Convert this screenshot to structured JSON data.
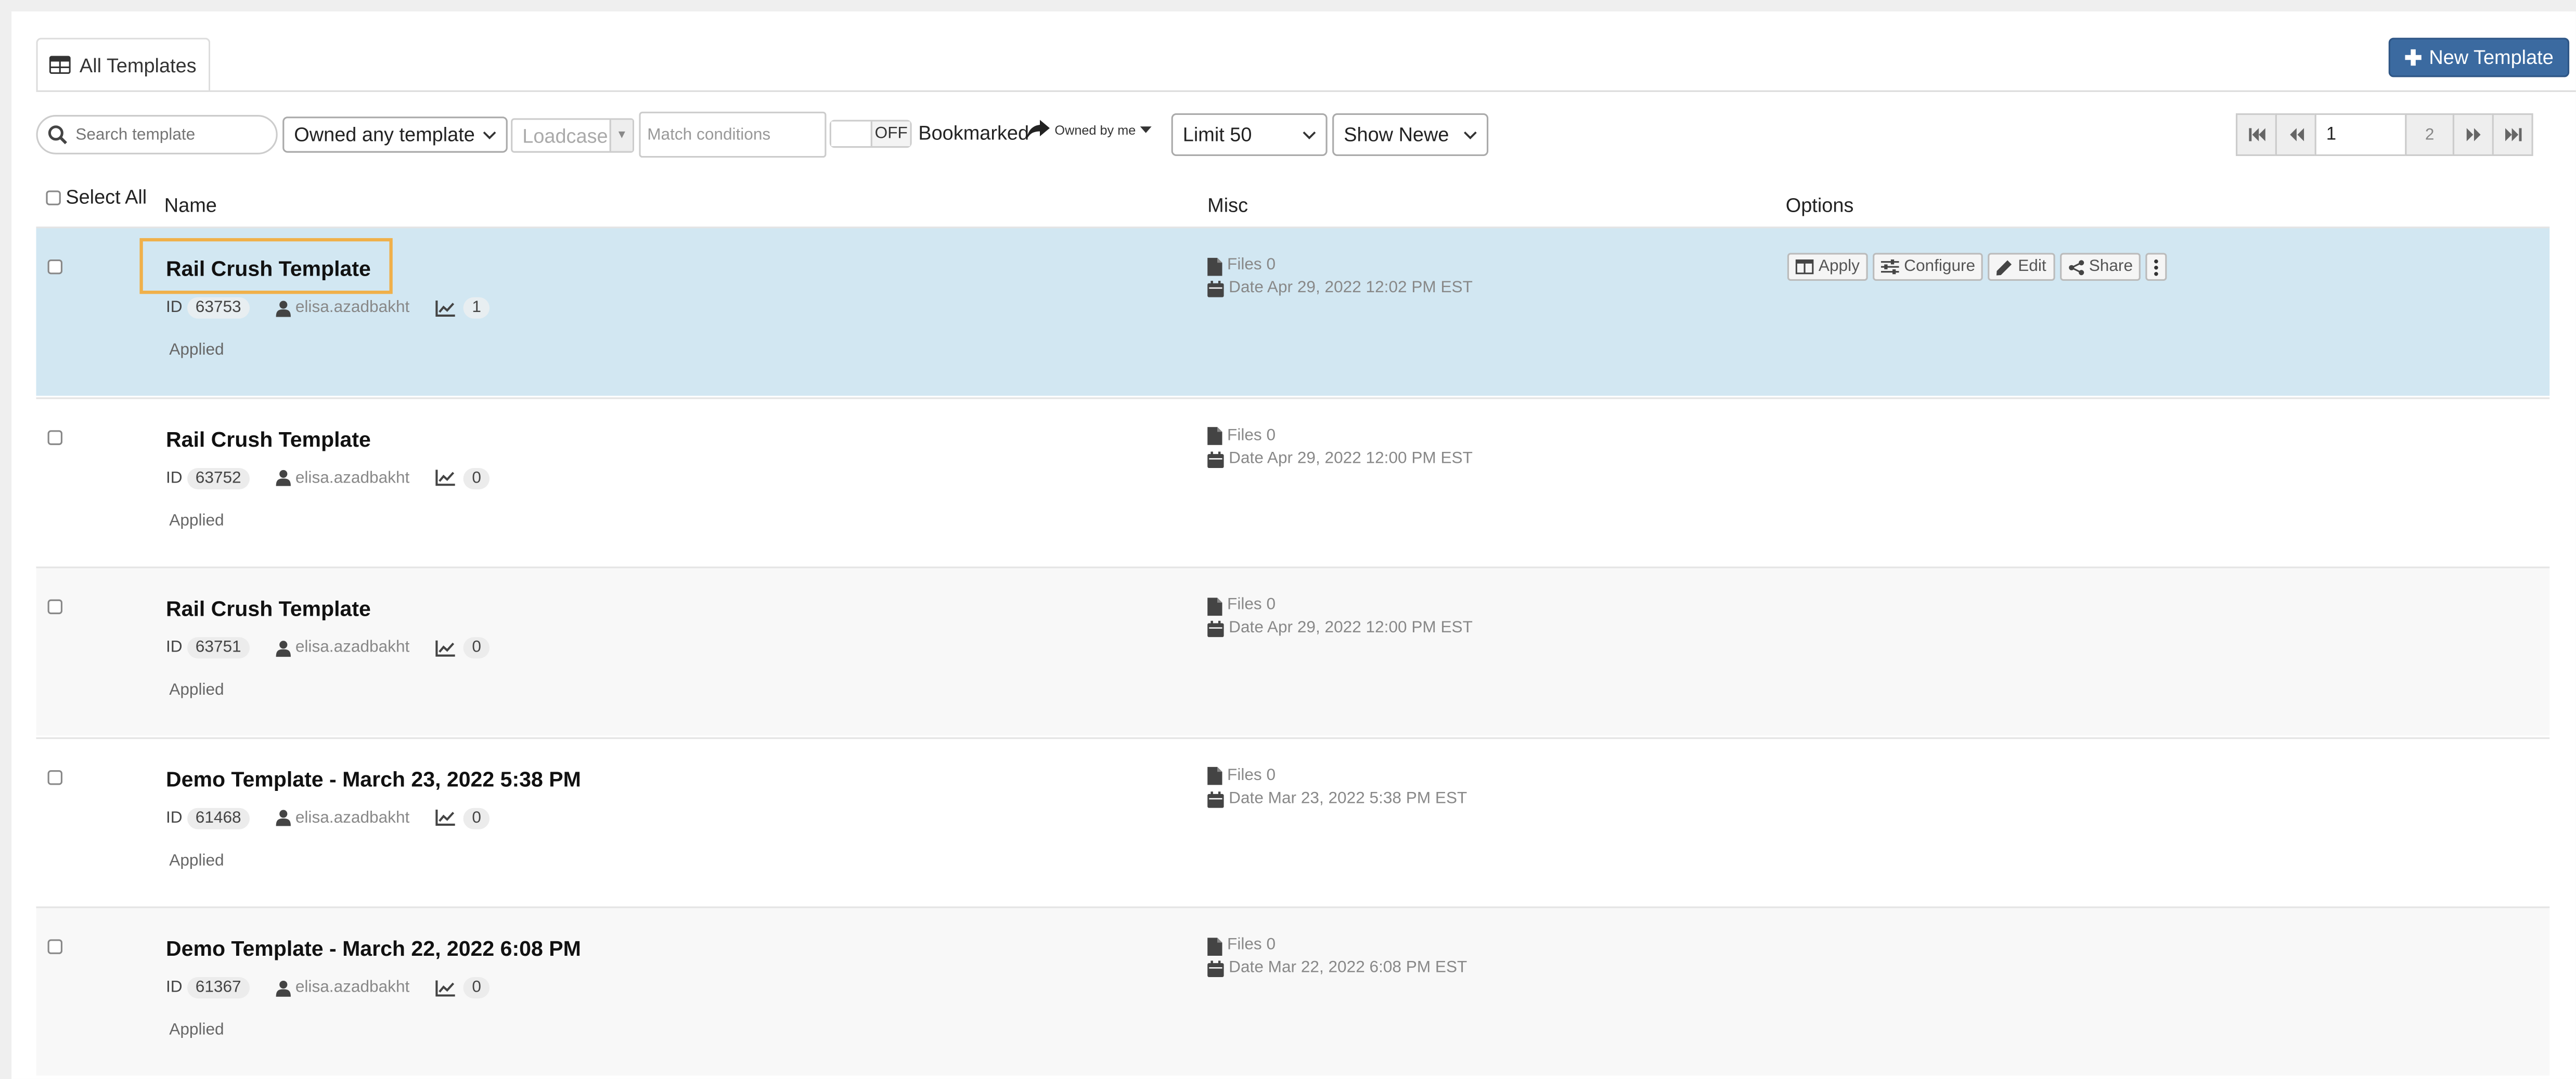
{
  "tabs": {
    "active_label": "All Templates"
  },
  "actions": {
    "new_template": "New Template"
  },
  "toolbar": {
    "search_placeholder": "Search template",
    "owner_filter": "Owned any template",
    "loadcase_placeholder": "Loadcase",
    "match_placeholder": "Match conditions",
    "toggle_state": "OFF",
    "bookmarked_label": "Bookmarked",
    "owned_by_label": "Owned by me",
    "limit_label": "Limit 50",
    "sort_label": "Show Newe"
  },
  "pager": {
    "current_page": "1",
    "total_pages": "2"
  },
  "table": {
    "select_all": "Select All",
    "col_name": "Name",
    "col_misc": "Misc",
    "col_options": "Options",
    "id_label": "ID",
    "files_prefix": "Files",
    "date_prefix": "Date",
    "rows": [
      {
        "name": "Rail Crush Template",
        "id": "63753",
        "user": "elisa.azadbakht",
        "count": "1",
        "status": "Applied",
        "files": "0",
        "date": "Apr 29, 2022 12:02 PM EST"
      },
      {
        "name": "Rail Crush Template",
        "id": "63752",
        "user": "elisa.azadbakht",
        "count": "0",
        "status": "Applied",
        "files": "0",
        "date": "Apr 29, 2022 12:00 PM EST"
      },
      {
        "name": "Rail Crush Template",
        "id": "63751",
        "user": "elisa.azadbakht",
        "count": "0",
        "status": "Applied",
        "files": "0",
        "date": "Apr 29, 2022 12:00 PM EST"
      },
      {
        "name": "Demo Template - March 23, 2022 5:38 PM",
        "id": "61468",
        "user": "elisa.azadbakht",
        "count": "0",
        "status": "Applied",
        "files": "0",
        "date": "Mar 23, 2022 5:38 PM EST"
      },
      {
        "name": "Demo Template - March 22, 2022 6:08 PM",
        "id": "61367",
        "user": "elisa.azadbakht",
        "count": "0",
        "status": "Applied",
        "files": "0",
        "date": "Mar 22, 2022 6:08 PM EST"
      }
    ]
  },
  "row_options": {
    "apply": "Apply",
    "configure": "Configure",
    "edit": "Edit",
    "share": "Share"
  },
  "colors": {
    "primary": "#3b6aa0",
    "selected_row": "#d2e7f2",
    "highlight": "#f0b04a"
  }
}
